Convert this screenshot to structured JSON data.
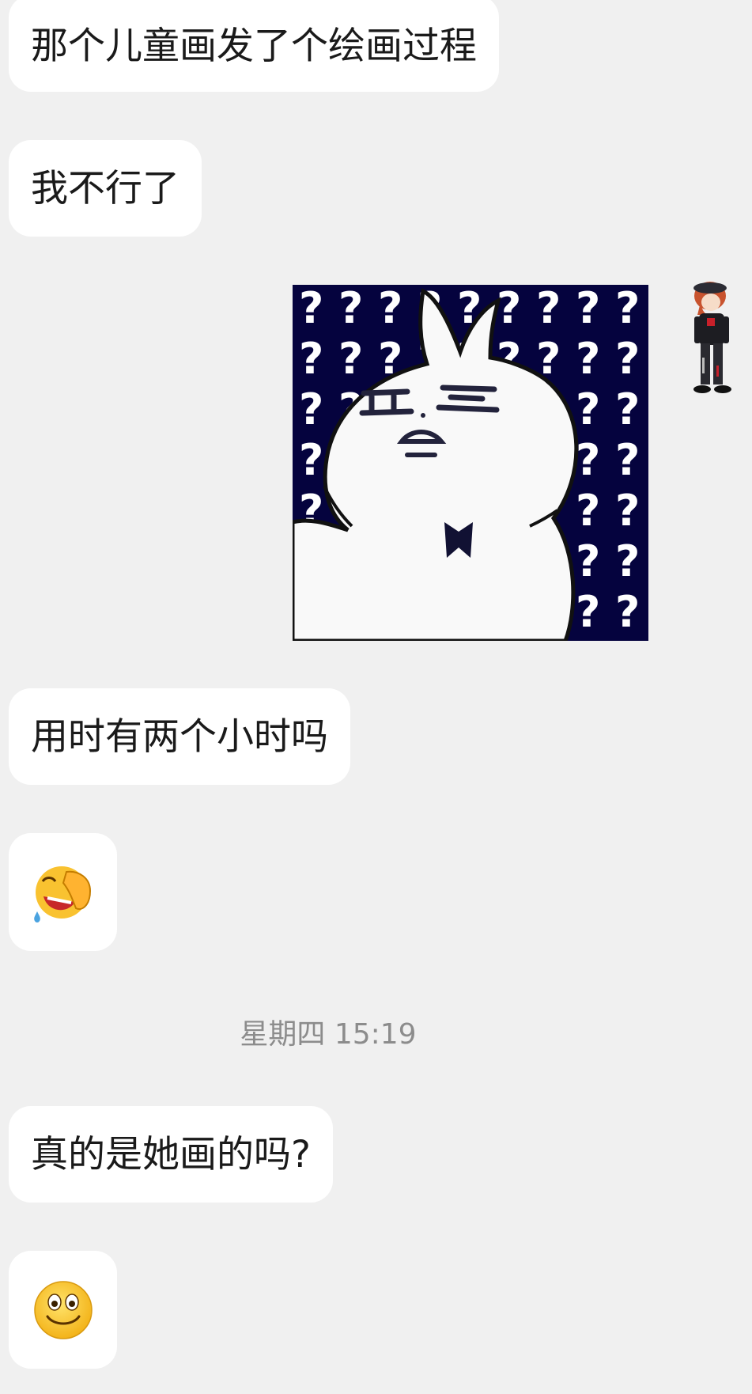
{
  "messages": {
    "m1": "那个儿童画发了个绘画过程",
    "m2": "我不行了",
    "m3": "用时有两个小时吗",
    "m5": "真的是她画的吗?"
  },
  "sticker": {
    "description_icon": "confused-bunny-sticker",
    "marks": "?????????"
  },
  "emoji": {
    "first": "facepalm-laugh-emoji",
    "second": "smile-emoji"
  },
  "timestamp": "星期四 15:19",
  "colors": {
    "background": "#f0f0f0",
    "bubble": "#ffffff",
    "sticker_bg": "#05033e"
  }
}
